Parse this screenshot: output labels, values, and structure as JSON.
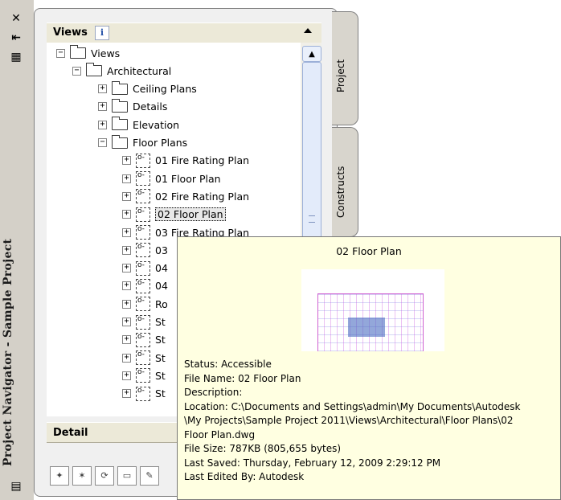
{
  "window": {
    "title": "Project Navigator - Sample Project",
    "buttons": [
      "close-icon",
      "auto-hide-icon",
      "properties-icon"
    ]
  },
  "views_panel": {
    "title": "Views",
    "info_label": "i",
    "tree": [
      {
        "label": "Views",
        "type": "folder",
        "expanded": true,
        "level": 0
      },
      {
        "label": "Architectural",
        "type": "folder",
        "expanded": true,
        "level": 1
      },
      {
        "label": "Ceiling Plans",
        "type": "folder",
        "expanded": false,
        "level": 2
      },
      {
        "label": "Details",
        "type": "folder",
        "expanded": false,
        "level": 2
      },
      {
        "label": "Elevation",
        "type": "folder",
        "expanded": false,
        "level": 2
      },
      {
        "label": "Floor Plans",
        "type": "folder",
        "expanded": true,
        "level": 2
      },
      {
        "label": "01 Fire Rating Plan",
        "type": "view",
        "level": 3
      },
      {
        "label": "01 Floor Plan",
        "type": "view",
        "level": 3
      },
      {
        "label": "02 Fire Rating Plan",
        "type": "view",
        "level": 3
      },
      {
        "label": "02 Floor Plan",
        "type": "view",
        "level": 3,
        "selected": true
      },
      {
        "label": "03 Fire Rating Plan",
        "type": "view",
        "level": 3
      },
      {
        "label": "03",
        "type": "view",
        "level": 3
      },
      {
        "label": "04",
        "type": "view",
        "level": 3
      },
      {
        "label": "04",
        "type": "view",
        "level": 3
      },
      {
        "label": "Ro",
        "type": "view",
        "level": 3
      },
      {
        "label": "St",
        "type": "view",
        "level": 3
      },
      {
        "label": "St",
        "type": "view",
        "level": 3
      },
      {
        "label": "St",
        "type": "view",
        "level": 3
      },
      {
        "label": "St",
        "type": "view",
        "level": 3
      },
      {
        "label": "St",
        "type": "view",
        "level": 3
      }
    ]
  },
  "tabs": [
    "Project",
    "Constructs"
  ],
  "detail": {
    "title": "Detail",
    "toolbar": [
      "new-view-icon",
      "new-category-icon",
      "regenerate-icon",
      "open-icon",
      "edit-icon"
    ]
  },
  "tooltip": {
    "title": "02 Floor Plan",
    "lines": [
      "Status: Accessible",
      "File Name: 02 Floor Plan",
      "Description:",
      "Location: C:\\Documents and Settings\\admin\\My Documents\\Autodesk",
      "\\My Projects\\Sample Project 2011\\Views\\Architectural\\Floor Plans\\02",
      "Floor Plan.dwg",
      "File Size: 787KB (805,655 bytes)",
      "Last Saved: Thursday, February 12, 2009  2:29:12 PM",
      "Last Edited By: Autodesk"
    ]
  }
}
